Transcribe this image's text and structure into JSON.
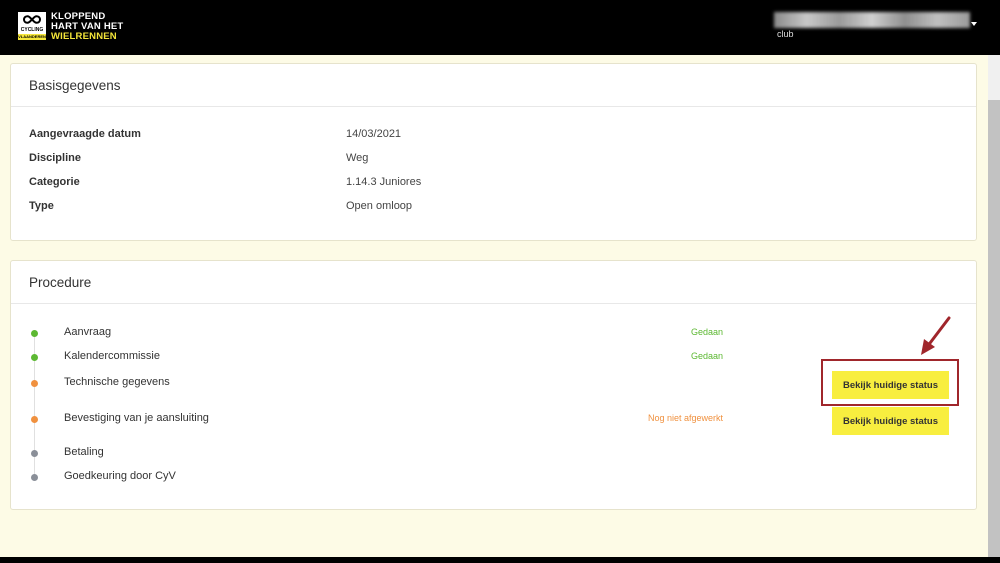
{
  "header": {
    "logo": {
      "badge_top": "CYCLING",
      "badge_bottom": "VLAANDEREN",
      "line1": "KLOPPEND",
      "line2": "HART VAN HET",
      "line3": "WIELRENNEN"
    },
    "user_role": "club"
  },
  "basisgegevens": {
    "title": "Basisgegevens",
    "rows": [
      {
        "label": "Aangevraagde datum",
        "value": "14/03/2021"
      },
      {
        "label": "Discipline",
        "value": "Weg"
      },
      {
        "label": "Categorie",
        "value": "1.14.3 Juniores"
      },
      {
        "label": "Type",
        "value": "Open omloop"
      }
    ]
  },
  "procedure": {
    "title": "Procedure",
    "steps": [
      {
        "label": "Aanvraag",
        "status": "Gedaan",
        "state": "done"
      },
      {
        "label": "Kalendercommissie",
        "status": "Gedaan",
        "state": "done"
      },
      {
        "label": "Technische gegevens",
        "status": "",
        "state": "pending",
        "button": "Bekijk huidige status"
      },
      {
        "label": "Bevestiging van je aansluiting",
        "status": "Nog niet afgewerkt",
        "state": "pending",
        "button": "Bekijk huidige status"
      },
      {
        "label": "Betaling",
        "status": "",
        "state": "todo"
      },
      {
        "label": "Goedkeuring door CyV",
        "status": "",
        "state": "todo"
      }
    ]
  },
  "colors": {
    "done": "#5cb832",
    "pending": "#f0913f",
    "todo": "#8a8f98",
    "button": "#f8ee3f",
    "annotation": "#a0262b"
  }
}
